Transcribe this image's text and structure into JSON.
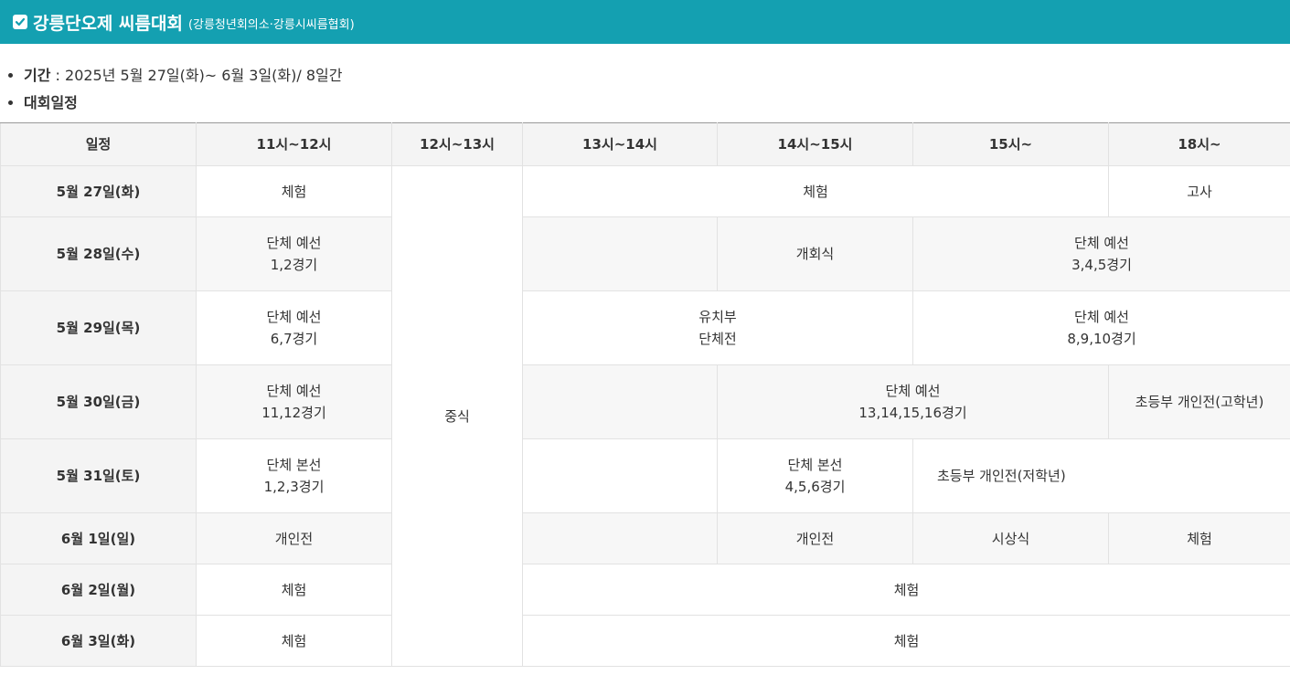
{
  "header": {
    "title": "강릉단오제 씨름대회",
    "subtitle": "(강릉청년회의소·강릉시씨름협회)",
    "accent_color": "#14a0b1",
    "icon": "checkbox-checked-icon"
  },
  "info": {
    "period_label": "기간",
    "period_value": " : 2025년 5월 27일(화)~ 6월 3일(화)/ 8일간",
    "schedule_label": "대회일정"
  },
  "table": {
    "headers": [
      "일정",
      "11시~12시",
      "12시~13시",
      "13시~14시",
      "14시~15시",
      "15시~",
      "18시~"
    ],
    "lunch": "중식",
    "rows": [
      {
        "date": "5월 27일(화)",
        "c1": "체험",
        "c2": "체험",
        "c3": "고사"
      },
      {
        "date": "5월 28일(수)",
        "c1": "단체 예선\n1,2경기",
        "c2": "",
        "c3": "개회식",
        "c4": "단체 예선\n3,4,5경기"
      },
      {
        "date": "5월 29일(목)",
        "c1": "단체 예선\n6,7경기",
        "c2": "유치부\n단체전",
        "c3": "단체 예선\n8,9,10경기"
      },
      {
        "date": "5월 30일(금)",
        "c1": "단체 예선\n11,12경기",
        "c2": "",
        "c3": "단체 예선\n13,14,15,16경기",
        "c4": "초등부 개인전(고학년)"
      },
      {
        "date": "5월 31일(토)",
        "c1": "단체 본선\n1,2,3경기",
        "c2": "",
        "c3": "단체 본선\n4,5,6경기",
        "c4": "초등부 개인전(저학년)"
      },
      {
        "date": "6월 1일(일)",
        "c1": "개인전",
        "c2": "",
        "c3": "개인전",
        "c4": "시상식",
        "c5": "체험"
      },
      {
        "date": "6월 2일(월)",
        "c1": "체험",
        "c2": "체험"
      },
      {
        "date": "6월 3일(화)",
        "c1": "체험",
        "c2": "체험"
      }
    ]
  }
}
